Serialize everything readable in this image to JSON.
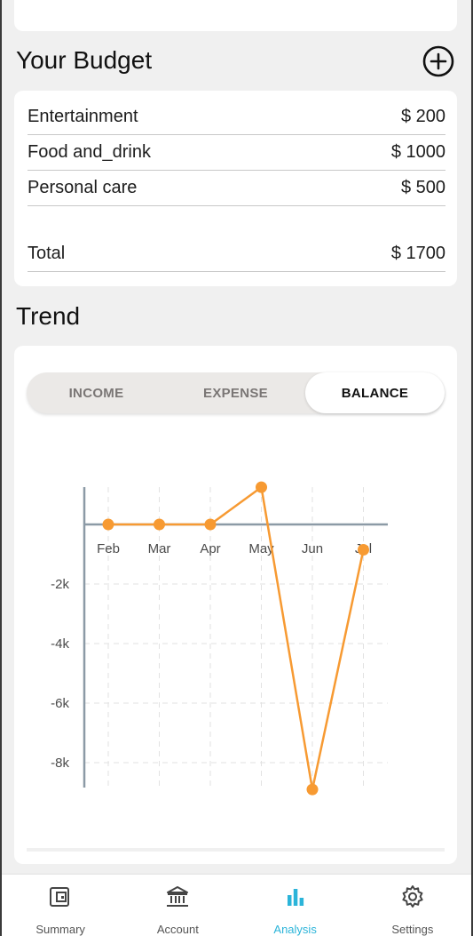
{
  "budget": {
    "title": "Your Budget",
    "items": [
      {
        "label": "Entertainment",
        "amount": "$ 200"
      },
      {
        "label": "Food and_drink",
        "amount": "$ 1000"
      },
      {
        "label": "Personal care",
        "amount": "$ 500"
      }
    ],
    "total_label": "Total",
    "total_amount": "$ 1700"
  },
  "trend": {
    "title": "Trend",
    "tabs": [
      "INCOME",
      "EXPENSE",
      "BALANCE"
    ],
    "active_tab": "BALANCE"
  },
  "chart_data": {
    "type": "line",
    "categories": [
      "Feb",
      "Mar",
      "Apr",
      "May",
      "Jun",
      "Jul"
    ],
    "series": [
      {
        "values": [
          0,
          0,
          0,
          1250,
          -8900,
          -850
        ]
      }
    ],
    "ytick_labels": [
      "-2k",
      "-4k",
      "-6k",
      "-8k"
    ],
    "yticks": [
      -2000,
      -4000,
      -6000,
      -8000
    ],
    "ylim": [
      -8900,
      1250
    ],
    "grid": true,
    "line_color": "#f79a32"
  },
  "nav": {
    "items": [
      {
        "label": "Summary",
        "icon": "wallet-icon"
      },
      {
        "label": "Account",
        "icon": "bank-icon"
      },
      {
        "label": "Analysis",
        "icon": "bar-chart-icon"
      },
      {
        "label": "Settings",
        "icon": "gear-icon"
      }
    ],
    "active": "Analysis",
    "active_color": "#2bb4d9"
  }
}
